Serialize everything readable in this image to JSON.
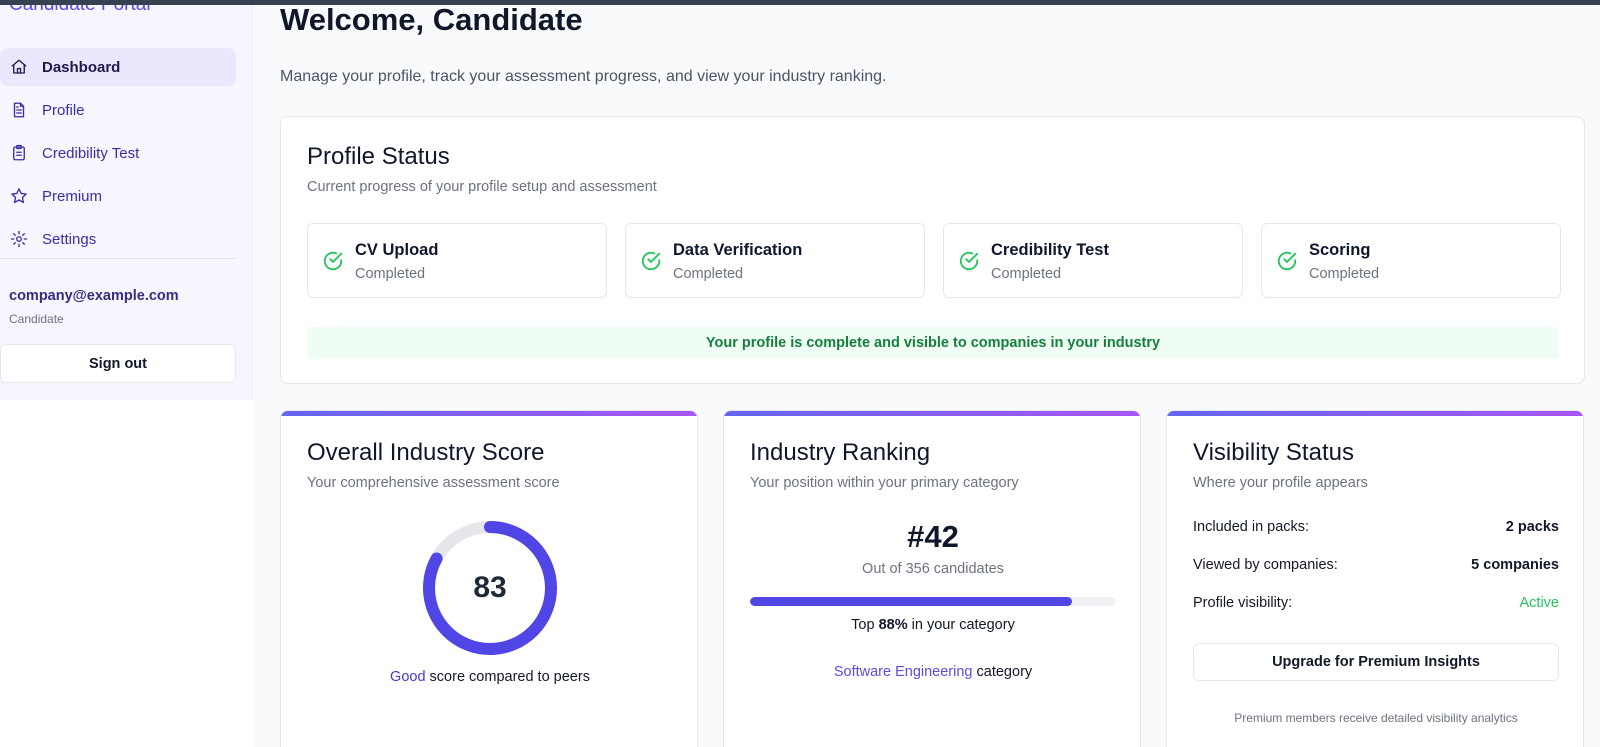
{
  "app": {
    "brand": "Candidate Portal"
  },
  "sidebar": {
    "items": [
      {
        "label": "Dashboard",
        "icon": "home-icon",
        "active": true
      },
      {
        "label": "Profile",
        "icon": "document-icon",
        "active": false
      },
      {
        "label": "Credibility Test",
        "icon": "clipboard-icon",
        "active": false
      },
      {
        "label": "Premium",
        "icon": "star-icon",
        "active": false
      },
      {
        "label": "Settings",
        "icon": "gear-icon",
        "active": false
      }
    ],
    "user": {
      "email": "company@example.com",
      "role": "Candidate"
    },
    "signout_label": "Sign out"
  },
  "header": {
    "title": "Welcome, Candidate",
    "subtitle": "Manage your profile, track your assessment progress, and view your industry ranking."
  },
  "profile_status": {
    "title": "Profile Status",
    "subtitle": "Current progress of your profile setup and assessment",
    "steps": [
      {
        "title": "CV Upload",
        "status": "Completed"
      },
      {
        "title": "Data Verification",
        "status": "Completed"
      },
      {
        "title": "Credibility Test",
        "status": "Completed"
      },
      {
        "title": "Scoring",
        "status": "Completed"
      }
    ],
    "banner": "Your profile is complete and visible to companies in your industry"
  },
  "score": {
    "title": "Overall Industry Score",
    "subtitle": "Your comprehensive assessment score",
    "value": "83",
    "value_fraction": 0.83,
    "rating": "Good",
    "caption_rest": " score compared to peers"
  },
  "ranking": {
    "title": "Industry Ranking",
    "subtitle": "Your position within your primary category",
    "rank": "#42",
    "out_of": "Out of 356 candidates",
    "progress_fraction": 0.88,
    "top_prefix": "Top ",
    "top_value": "88%",
    "top_suffix": " in your category",
    "category_name": "Software Engineering",
    "category_suffix": " category"
  },
  "visibility": {
    "title": "Visibility Status",
    "subtitle": "Where your profile appears",
    "rows": [
      {
        "label": "Included in packs:",
        "value": "2 packs"
      },
      {
        "label": "Viewed by companies:",
        "value": "5 companies"
      },
      {
        "label": "Profile visibility:",
        "value": "Active"
      }
    ],
    "upgrade_label": "Upgrade for Premium Insights",
    "note": "Premium members receive detailed visibility analytics"
  },
  "colors": {
    "accent": "#4f46e5",
    "success": "#22c55e",
    "success_text": "#15803d",
    "sidebar_bg": "#f7f5ff"
  }
}
